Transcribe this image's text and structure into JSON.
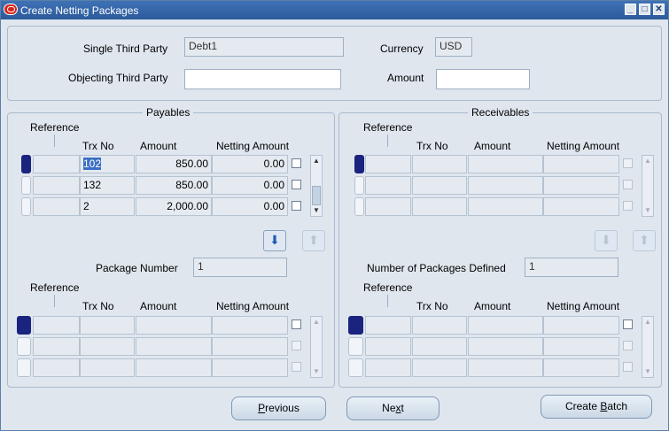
{
  "window": {
    "title": "Create Netting Packages"
  },
  "header": {
    "single_third_party_label": "Single Third Party",
    "single_third_party_value": "Debt1",
    "currency_label": "Currency",
    "currency_value": "USD",
    "objecting_third_party_label": "Objecting Third Party",
    "objecting_third_party_value": "",
    "amount_label": "Amount",
    "amount_value": ""
  },
  "payables": {
    "title": "Payables",
    "columns": {
      "reference": "Reference",
      "trx_no": "Trx No",
      "amount": "Amount",
      "netting_amount": "Netting Amount"
    },
    "rows": [
      {
        "reference": "",
        "trx_no": "102",
        "amount": "850.00",
        "netting_amount": "0.00"
      },
      {
        "reference": "",
        "trx_no": "132",
        "amount": "850.00",
        "netting_amount": "0.00"
      },
      {
        "reference": "",
        "trx_no": "2",
        "amount": "2,000.00",
        "netting_amount": "0.00"
      }
    ],
    "package_number_label": "Package Number",
    "package_number_value": "1",
    "lower_columns": {
      "reference": "Reference",
      "trx_no": "Trx No",
      "amount": "Amount",
      "netting_amount": "Netting Amount"
    }
  },
  "receivables": {
    "title": "Receivables",
    "columns": {
      "reference": "Reference",
      "trx_no": "Trx No",
      "amount": "Amount",
      "netting_amount": "Netting Amount"
    },
    "packages_defined_label": "Number of Packages Defined",
    "packages_defined_value": "1",
    "lower_columns": {
      "reference": "Reference",
      "trx_no": "Trx No",
      "amount": "Amount",
      "netting_amount": "Netting Amount"
    }
  },
  "buttons": {
    "previous_first": "P",
    "previous_rest": "revious",
    "next_pre": "Ne",
    "next_u": "x",
    "next_post": "t",
    "create_batch_pre": "Create ",
    "create_batch_u": "B",
    "create_batch_post": "atch"
  },
  "icons": {
    "app": "oracle-icon",
    "minimize": "minimize-icon",
    "maximize": "maximize-icon",
    "close": "close-icon",
    "move_down": "arrow-down-icon",
    "move_up": "arrow-up-icon"
  },
  "colors": {
    "titlebar": "#2b5a9a",
    "background": "#dfe6ee",
    "active_row": "#1a237e",
    "selection": "#3b6fc4"
  }
}
